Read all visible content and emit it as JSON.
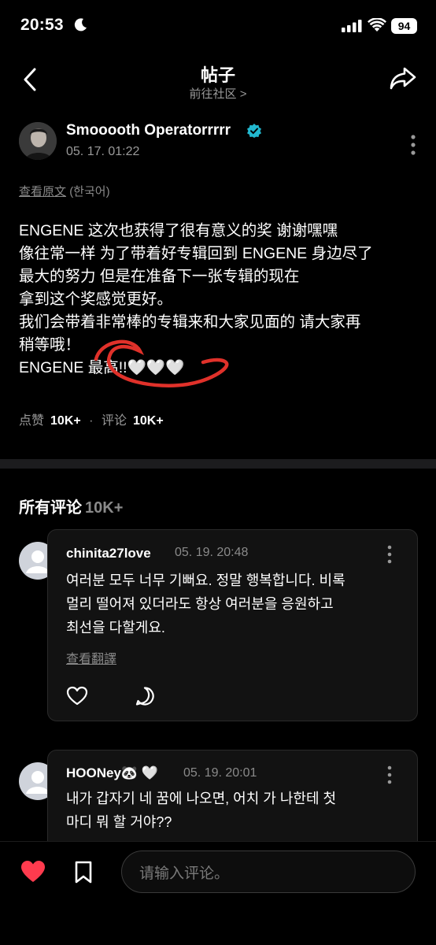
{
  "status_bar": {
    "time": "20:53",
    "battery": "94"
  },
  "header": {
    "title": "帖子",
    "subtitle": "前往社区 >"
  },
  "post": {
    "author": "Smooooth Operatorrrrr",
    "time": "05. 17. 01:22",
    "view_original": "查看原文",
    "original_lang": "(한국어)",
    "body": "ENGENE 这次也获得了很有意义的奖 谢谢嘿嘿\n像往常一样 为了带着好专辑回到 ENGENE 身边尽了\n最大的努力 但是在准备下一张专辑的现在\n拿到这个奖感觉更好。\n我们会带着非常棒的专辑来和大家见面的 请大家再\n稍等哦！\nENGENE 最高!!🤍🤍🤍",
    "likes_label": "点赞",
    "likes": "10K+",
    "sep": "·",
    "comments_label": "评论",
    "comments": "10K+"
  },
  "comments_section": {
    "title": "所有评论",
    "count": "10K+"
  },
  "comments": [
    {
      "user": "chinita27love",
      "time": "05. 19. 20:48",
      "text": "여러분 모두 너무 기뻐요. 정말 행복합니다. 비록\n멀리 떨어져 있더라도 항상 여러분을 응원하고\n최선을 다할게요.",
      "translate": "查看翻譯"
    },
    {
      "user": "HOONey🐼 🤍",
      "time": "05. 19. 20:01",
      "text": "내가 갑자기 네 꿈에 나오면, 어치 가 나한테 첫\n마디 뭐 할 거야??"
    }
  ],
  "bottom_bar": {
    "input_placeholder": "请输入评论。"
  },
  "colors": {
    "background": "#000000",
    "verified": "#22b8cf",
    "annotation": "#e0312a",
    "like": "#ff3b4e"
  },
  "icons": [
    "moon-icon",
    "signal-icon",
    "wifi-icon",
    "back-icon",
    "share-icon",
    "verified-icon",
    "more-icon",
    "heart-icon",
    "comment-icon",
    "bookmark-icon"
  ]
}
